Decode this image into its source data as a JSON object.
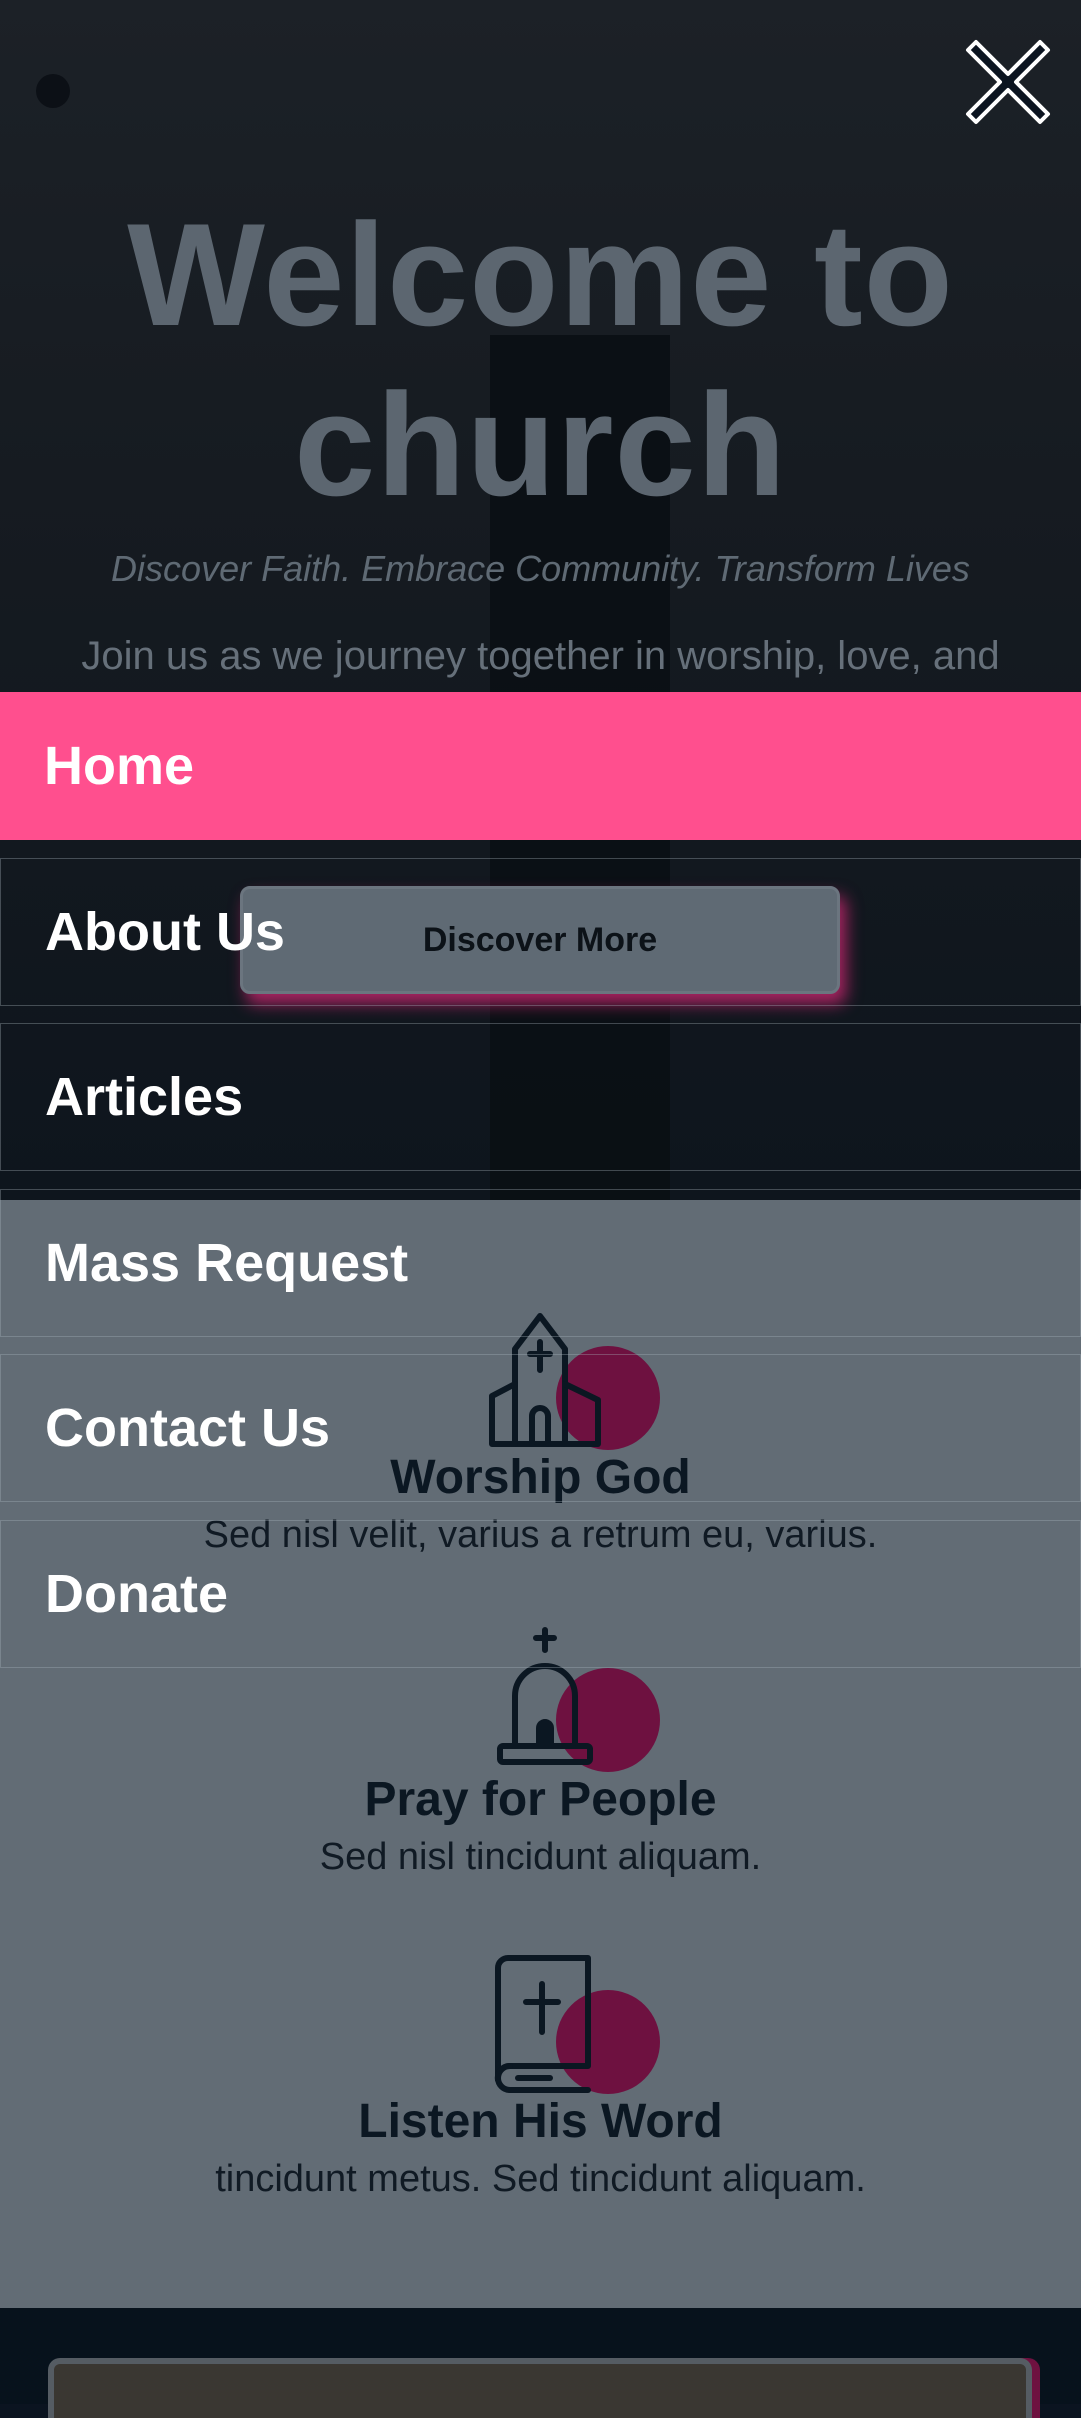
{
  "hero": {
    "title_line1": "Welcome to",
    "title_line2": "church",
    "tagline": "Discover Faith. Embrace Community. Transform Lives",
    "intro": "Join us as we journey together in worship, love, and",
    "cta_label": "Discover More"
  },
  "features": [
    {
      "icon": "church-icon",
      "title": "Worship God",
      "text": "Sed nisl velit, varius a retrum eu, varius."
    },
    {
      "icon": "prayer-bell-icon",
      "title": "Pray for People",
      "text": "Sed nisl tincidunt aliquam."
    },
    {
      "icon": "bible-icon",
      "title": "Listen His Word",
      "text": "tincidunt metus. Sed tincidunt aliquam."
    }
  ],
  "menu": {
    "items": [
      {
        "label": "Home",
        "active": true
      },
      {
        "label": "About Us",
        "active": false
      },
      {
        "label": "Articles",
        "active": false
      },
      {
        "label": "Mass Request",
        "active": false
      },
      {
        "label": "Contact Us",
        "active": false
      },
      {
        "label": "Donate",
        "active": false
      }
    ],
    "close_icon": "close-icon"
  },
  "colors": {
    "accent": "#ff4f8e",
    "blob": "#6e1140",
    "features_bg": "#626c75"
  }
}
